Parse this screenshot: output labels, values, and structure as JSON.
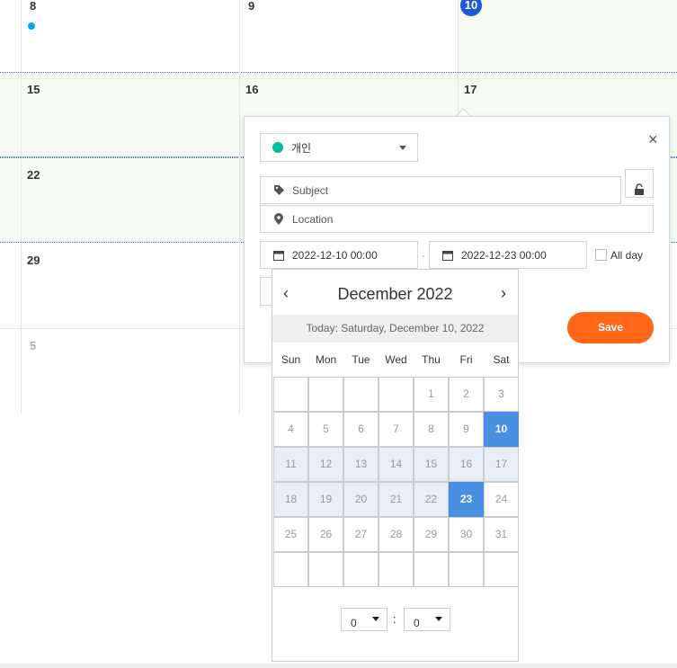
{
  "calendar": {
    "rows": [
      {
        "days": [
          "8",
          "9",
          "10"
        ]
      },
      {
        "days": [
          "15",
          "16",
          "17"
        ]
      },
      {
        "days": [
          "22",
          "",
          ""
        ]
      },
      {
        "days": [
          "29",
          "",
          ""
        ]
      },
      {
        "days": [
          "5",
          "",
          ""
        ]
      }
    ],
    "today": "10"
  },
  "popup": {
    "calendar_select": {
      "label": "개인",
      "color": "#03bd9e"
    },
    "subject": {
      "placeholder": "Subject"
    },
    "location": {
      "placeholder": "Location"
    },
    "start_date": "2022-12-10 00:00",
    "end_date": "2022-12-23 00:00",
    "date_separator": "-",
    "all_day_label": "All day",
    "save_label": "Save",
    "close": "×"
  },
  "datepicker": {
    "title": "December 2022",
    "prev": "‹",
    "next": "›",
    "today_text": "Today: Saturday, December 10, 2022",
    "weekdays": [
      "Sun",
      "Mon",
      "Tue",
      "Wed",
      "Thu",
      "Fri",
      "Sat"
    ],
    "weeks": [
      [
        "",
        "",
        "",
        "",
        "1",
        "2",
        "3"
      ],
      [
        "4",
        "5",
        "6",
        "7",
        "8",
        "9",
        "10"
      ],
      [
        "11",
        "12",
        "13",
        "14",
        "15",
        "16",
        "17"
      ],
      [
        "18",
        "19",
        "20",
        "21",
        "22",
        "23",
        "24"
      ],
      [
        "25",
        "26",
        "27",
        "28",
        "29",
        "30",
        "31"
      ],
      [
        "",
        "",
        "",
        "",
        "",
        "",
        ""
      ]
    ],
    "start_day": "10",
    "end_day": "23",
    "hour": "0",
    "minute": "0",
    "colon": ":"
  },
  "colors": {
    "accent_save": "#ff6618",
    "selected_day": "#4a90e2",
    "today_badge": "#1f5ad6",
    "selection_bg": "#f4fbf2"
  }
}
